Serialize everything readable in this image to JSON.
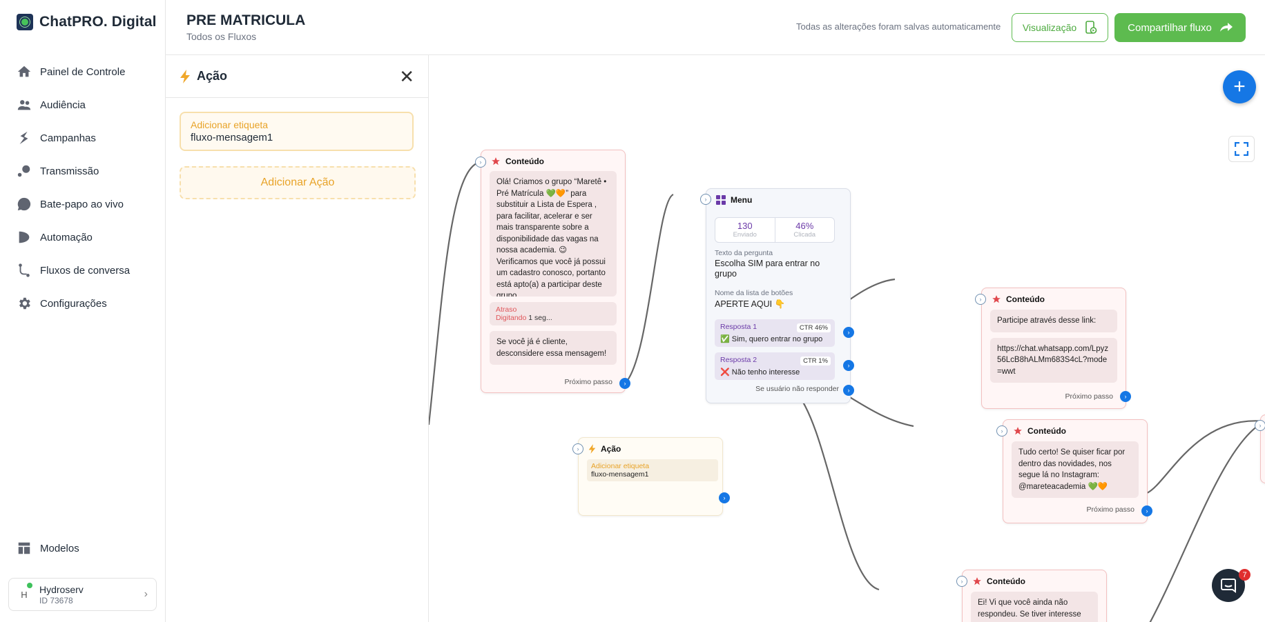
{
  "brand": {
    "name": "ChatPRO. Digital"
  },
  "nav": [
    {
      "label": "Painel de Controle",
      "icon": "home-icon"
    },
    {
      "label": "Audiência",
      "icon": "users-icon"
    },
    {
      "label": "Campanhas",
      "icon": "campaign-icon"
    },
    {
      "label": "Transmissão",
      "icon": "broadcast-icon"
    },
    {
      "label": "Bate-papo ao vivo",
      "icon": "chat-bubble-icon"
    },
    {
      "label": "Automação",
      "icon": "automation-icon"
    },
    {
      "label": "Fluxos de conversa",
      "icon": "flow-icon"
    },
    {
      "label": "Configurações",
      "icon": "gear-icon"
    }
  ],
  "nav_bottom": {
    "label": "Modelos",
    "icon": "templates-icon"
  },
  "account": {
    "initial": "H",
    "name": "Hydroserv",
    "id": "ID 73678"
  },
  "header": {
    "title": "PRE MATRICULA",
    "subtitle": "Todos os Fluxos",
    "status": "Todas as alterações foram salvas automaticamente",
    "preview_label": "Visualização",
    "share_label": "Compartilhar fluxo"
  },
  "panel": {
    "title": "Ação",
    "tag_label": "Adicionar etiqueta",
    "tag_value": "fluxo-mensagem1",
    "add_action": "Adicionar Ação"
  },
  "nodes": {
    "content1": {
      "title": "Conteúdo",
      "message": "Olá! Criamos o grupo “Maretê • Pré Matrícula 💚🧡” para substituir a Lista de Espera , para facilitar, acelerar e ser mais transparente sobre a disponibilidade das vagas na nossa academia. 😉 Verificamos que você já possui um cadastro conosco, portanto está apto(a) a participar deste grupo.",
      "delay_label": "Atraso",
      "delay_typing": "Digitando",
      "delay_value": "1 seg...",
      "message2": "Se você já é cliente, desconsidere essa mensagem!",
      "next": "Próximo passo"
    },
    "menu": {
      "title": "Menu",
      "sent_value": "130",
      "sent_label": "Enviado",
      "clicked_value": "46%",
      "clicked_label": "Clicada",
      "question_label": "Texto da pergunta",
      "question": "Escolha SIM para entrar no grupo",
      "list_label": "Nome da lista de botões",
      "list_name": "APERTE AQUI 👇",
      "responses": [
        {
          "label": "Resposta 1",
          "ctr": "CTR 46%",
          "text": "✅ Sim, quero entrar no grupo"
        },
        {
          "label": "Resposta 2",
          "ctr": "CTR 1%",
          "text": "❌ Não tenho interesse"
        }
      ],
      "no_reply": "Se usuário não responder"
    },
    "action": {
      "title": "Ação",
      "tag_label": "Adicionar etiqueta",
      "tag_value": "fluxo-mensagem1"
    },
    "content2": {
      "title": "Conteúdo",
      "message": "Participe através desse link:",
      "link": "https://chat.whatsapp.com/Lpyz56LcB8hALMm683S4cL?mode=wwt",
      "next": "Próximo passo"
    },
    "content3": {
      "title": "Conteúdo",
      "message": "Tudo certo! Se quiser ficar por dentro das novidades, nos segue lá no Instagram: @mareteacademia 💚🧡",
      "next": "Próximo passo"
    },
    "content4": {
      "title": "Conteúdo",
      "message": "Ei! Vi que você ainda não respondeu. Se tiver interesse em e"
    }
  },
  "chat_badge": "7",
  "colors": {
    "accent": "#1577e5",
    "green": "#5dbb4f",
    "orange": "#e8a328",
    "content_star": "#e0474c"
  }
}
